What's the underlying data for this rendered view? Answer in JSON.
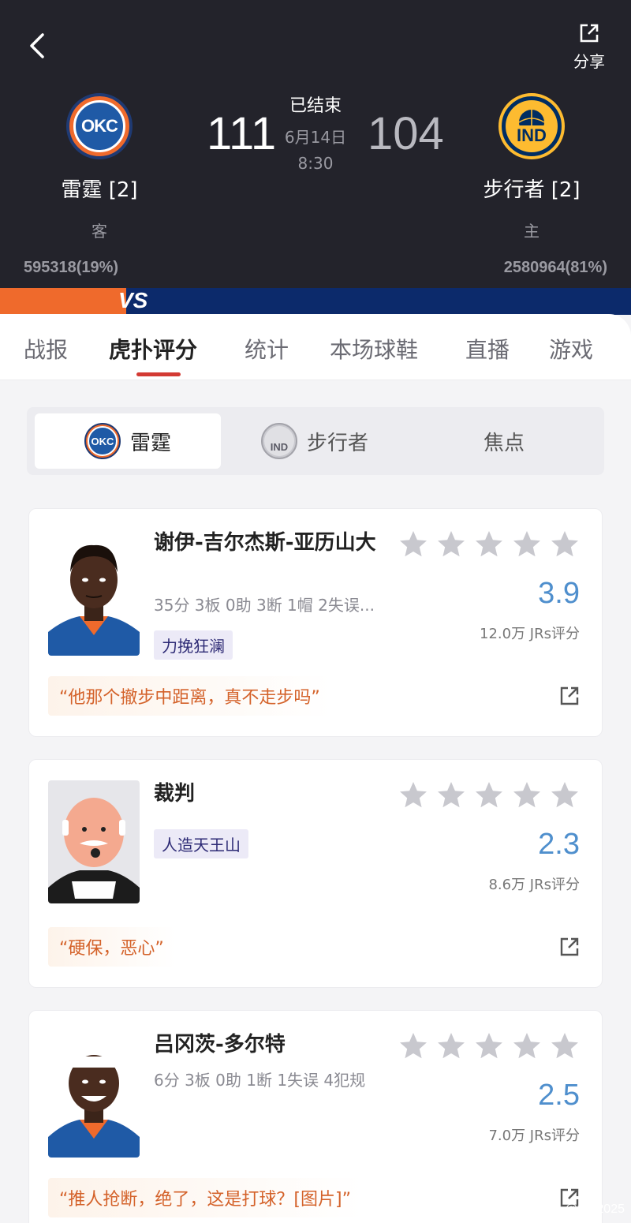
{
  "header": {
    "share_label": "分享",
    "away": {
      "logo_text": "OKC",
      "name": "雷霆 [2]",
      "role": "客",
      "score": "111",
      "support": "595318(19%)"
    },
    "home": {
      "logo_text": "IND",
      "name": "步行者 [2]",
      "role": "主",
      "score": "104",
      "support": "2580964(81%)"
    },
    "status": "已结束",
    "date": "6月14日",
    "time": "8:30",
    "vs_text": "VS"
  },
  "tabs": [
    {
      "label": "战报"
    },
    {
      "label": "虎扑评分"
    },
    {
      "label": "统计"
    },
    {
      "label": "本场球鞋"
    },
    {
      "label": "直播"
    },
    {
      "label": "游戏"
    }
  ],
  "active_tab": "虎扑评分",
  "segment": {
    "okc_label": "雷霆",
    "okc_logo": "OKC",
    "ind_label": "步行者",
    "ind_logo": "IND",
    "focus_label": "焦点"
  },
  "cards": [
    {
      "name": "谢伊-吉尔杰斯-亚历山大",
      "stats": "35分 3板 0助 3断 1帽 2失误...",
      "tag": "力挽狂澜",
      "rating": "3.9",
      "rating_count": "12.0万 JRs评分",
      "quote": "“他那个撤步中距离，真不走步吗”",
      "stars_fill": 0
    },
    {
      "name": "裁判",
      "stats": "",
      "tag": "人造天王山",
      "rating": "2.3",
      "rating_count": "8.6万 JRs评分",
      "quote": "“硬保，恶心”",
      "stars_fill": 0
    },
    {
      "name": "吕冈茨-多尔特",
      "stats": "6分 3板 0助 1断 1失误 4犯规",
      "tag": "",
      "rating": "2.5",
      "rating_count": "7.0万 JRs评分",
      "quote": "“推人抢断，绝了，这是打球？[图片]”",
      "stars_fill": 0
    }
  ],
  "watermark": "@win2025",
  "colors": {
    "accent": "#d33a33",
    "rating": "#4f8fcd",
    "okc_orange": "#ef6a2c",
    "okc_blue": "#1f5aa6",
    "ind_navy": "#002d62",
    "ind_gold": "#fdbb30"
  }
}
